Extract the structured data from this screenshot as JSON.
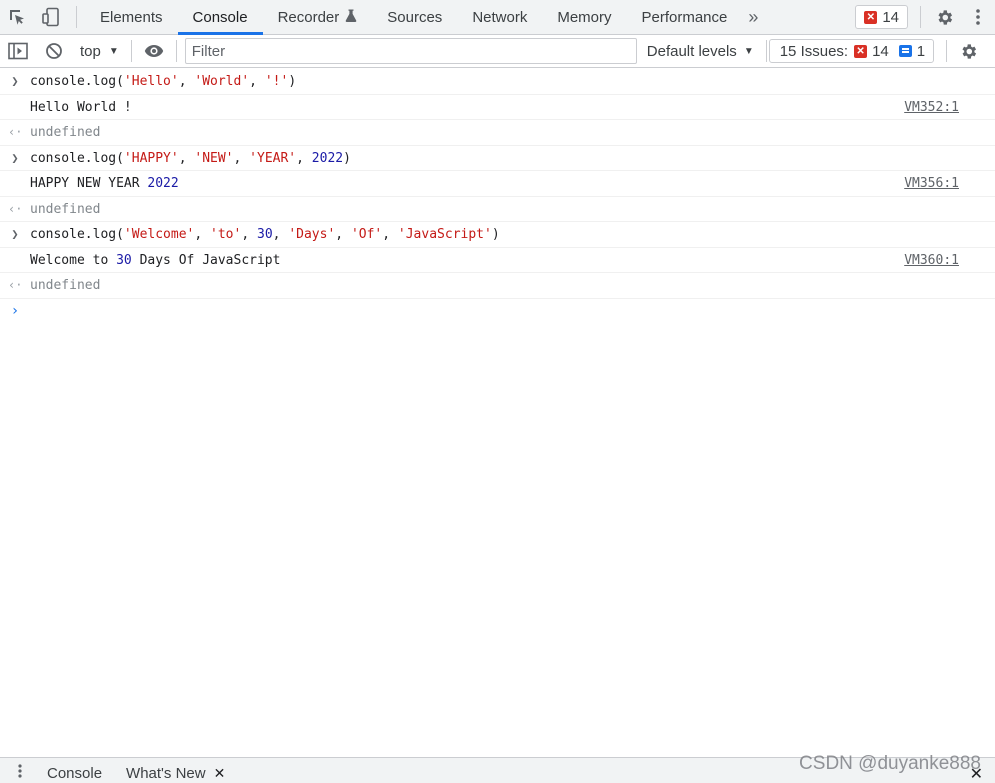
{
  "tabbar": {
    "tabs": [
      {
        "label": "Elements"
      },
      {
        "label": "Console"
      },
      {
        "label": "Recorder"
      },
      {
        "label": "Sources"
      },
      {
        "label": "Network"
      },
      {
        "label": "Memory"
      },
      {
        "label": "Performance"
      }
    ],
    "active_tab": "Console",
    "more_tabs_label": "»",
    "error_count": "14"
  },
  "toolbar": {
    "context": "top",
    "filter_placeholder": "Filter",
    "filter_value": "",
    "levels_label": "Default levels",
    "issues_label": "15 Issues:",
    "issues_errors": "14",
    "issues_info": "1"
  },
  "console": {
    "entries": [
      {
        "command": [
          "console.log(",
          "'Hello'",
          ", ",
          "'World'",
          ", ",
          "'!'",
          ")"
        ],
        "output": "Hello World !",
        "source": "VM352:1",
        "result": "undefined"
      },
      {
        "command": [
          "console.log(",
          "'HAPPY'",
          ", ",
          "'NEW'",
          ", ",
          "'YEAR'",
          ", ",
          "2022",
          ")"
        ],
        "output_parts": [
          "HAPPY NEW YEAR ",
          "2022"
        ],
        "source": "VM356:1",
        "result": "undefined"
      },
      {
        "command": [
          "console.log(",
          "'Welcome'",
          ", ",
          "'to'",
          ", ",
          "30",
          ", ",
          "'Days'",
          ", ",
          "'Of'",
          ", ",
          "'JavaScript'",
          ")"
        ],
        "output_parts": [
          "Welcome to ",
          "30",
          " Days Of JavaScript"
        ],
        "source": "VM360:1",
        "result": "undefined"
      }
    ]
  },
  "drawer": {
    "tabs": [
      {
        "label": "Console"
      },
      {
        "label": "What's New"
      }
    ]
  },
  "watermark": "CSDN @duyanke888",
  "colors": {
    "accent": "#1a73e8",
    "error": "#d93025",
    "string": "#a31515",
    "number": "#1a1aa6"
  }
}
